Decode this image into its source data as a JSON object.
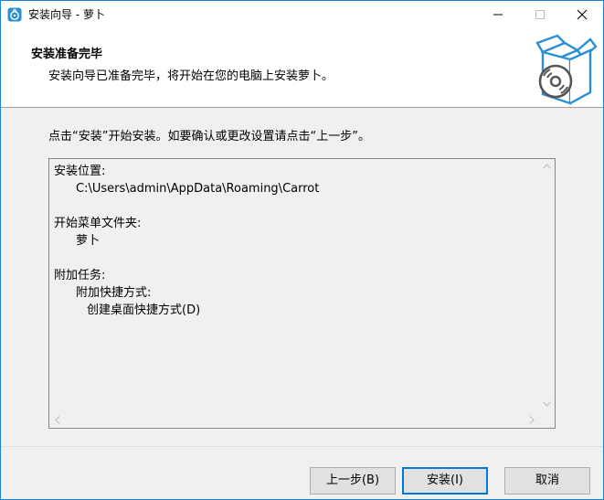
{
  "window": {
    "title": "安装向导 - 萝卜"
  },
  "header": {
    "title": "安装准备完毕",
    "subtitle": "安装向导已准备完毕，将开始在您的电脑上安装萝卜。"
  },
  "instruction": "点击“安装”开始安装。如要确认或更改设置请点击“上一步”。",
  "memo": {
    "location_label": "安装位置:",
    "location_value": "C:\\Users\\admin\\AppData\\Roaming\\Carrot",
    "startmenu_label": "开始菜单文件夹:",
    "startmenu_value": "萝卜",
    "tasks_label": "附加任务:",
    "tasks_group": "附加快捷方式:",
    "tasks_item": "创建桌面快捷方式(D)"
  },
  "buttons": {
    "back": "上一步(B)",
    "install": "安装(I)",
    "cancel": "取消"
  },
  "colors": {
    "accent": "#0078d7",
    "window_border": "#1883d7",
    "icon_blue": "#2b8fd6"
  }
}
